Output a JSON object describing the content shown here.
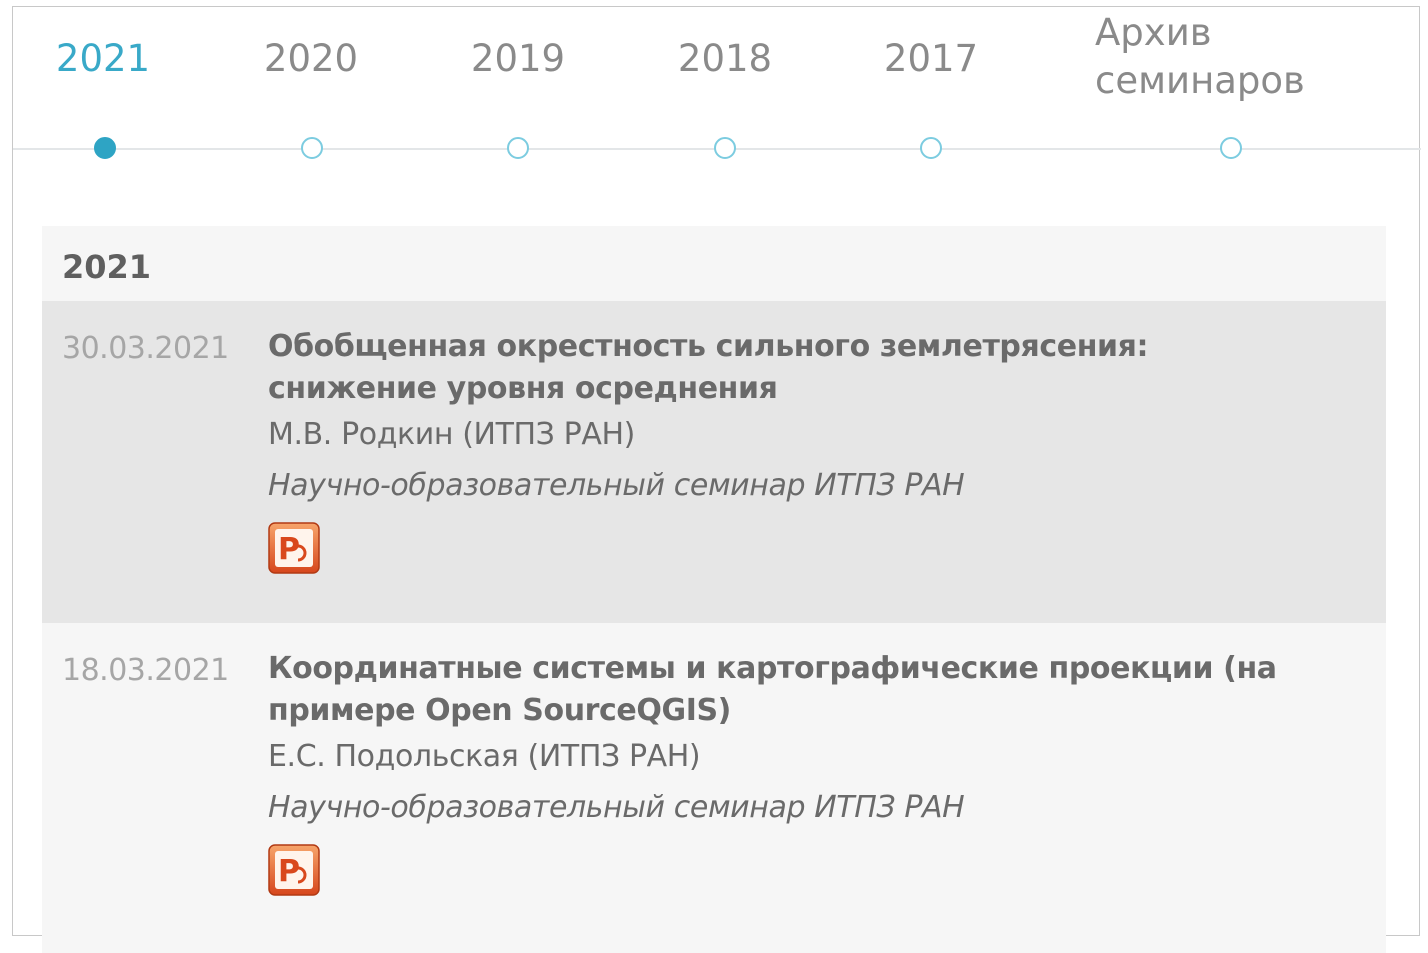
{
  "tabs": [
    {
      "label": "2021",
      "active": true
    },
    {
      "label": "2020",
      "active": false
    },
    {
      "label": "2019",
      "active": false
    },
    {
      "label": "2018",
      "active": false
    },
    {
      "label": "2017",
      "active": false
    }
  ],
  "archive_tab": {
    "line1": "Архив",
    "line2": "семинаров"
  },
  "section": {
    "year": "2021"
  },
  "events": [
    {
      "date": "30.03.2021",
      "title_line1": "Обобщенная окрестность сильного землетрясения:",
      "title_line2": "снижение уровня осреднения",
      "author": "М.В. Родкин (ИТПЗ РАН)",
      "seminar": "Научно-образовательный семинар ИТПЗ РАН",
      "attachment_icon": "powerpoint-icon"
    },
    {
      "date": "18.03.2021",
      "title_line1": "Координатные системы и картографические проекции (на",
      "title_line2": "примере Open SourceQGIS)",
      "author": "Е.С. Подольская (ИТПЗ РАН)",
      "seminar": "Научно-образовательный семинар ИТПЗ РАН",
      "attachment_icon": "powerpoint-icon"
    }
  ],
  "colors": {
    "accent": "#2ea4c4",
    "accent_light": "#7ccce0",
    "text": "#6a6a6a",
    "date": "#a6a6a6",
    "ppt_orange": "#e8632c"
  }
}
